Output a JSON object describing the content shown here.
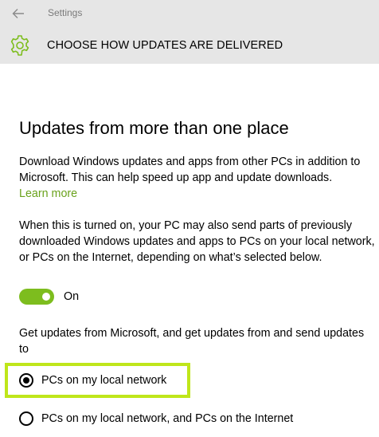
{
  "window": {
    "app_title": "Settings",
    "back_icon": "back-arrow-icon"
  },
  "header": {
    "icon": "gear-icon",
    "title": "CHOOSE HOW UPDATES ARE DELIVERED"
  },
  "section": {
    "title": "Updates from more than one place",
    "description": "Download Windows updates and apps from other PCs in addition to Microsoft. This can help speed up app and update downloads.",
    "learn_more": "Learn more",
    "detail": "When this is turned on, your PC may also send parts of previously downloaded Windows updates and apps to PCs on your local network, or PCs on the Internet, depending on what’s selected below.",
    "toggle": {
      "state_label": "On",
      "on": true
    },
    "radio_prompt": "Get updates from Microsoft, and get updates from and send updates to",
    "options": [
      {
        "label": "PCs on my local network",
        "selected": true
      },
      {
        "label": "PCs on my local network, and PCs on the Internet",
        "selected": false
      }
    ]
  },
  "colors": {
    "accent": "#7dbd1e",
    "link": "#6aa21c",
    "highlight": "#bfe61a",
    "header_bg": "#e6e6e6"
  }
}
